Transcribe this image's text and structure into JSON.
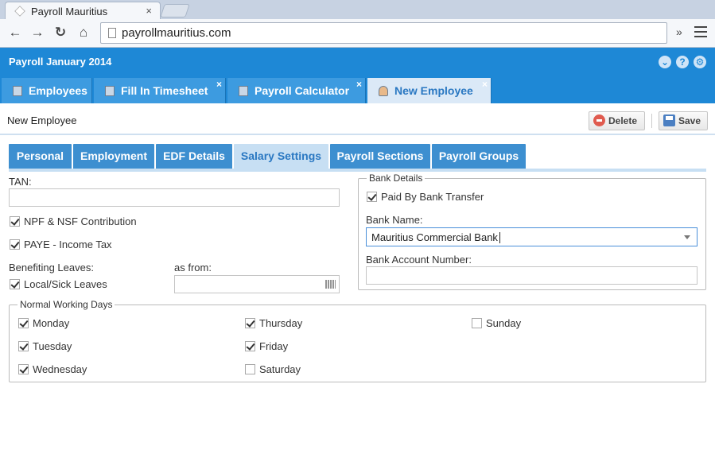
{
  "browser": {
    "tab_title": "Payroll Mauritius",
    "tab_close": "×",
    "url": "payrollmauritius.com",
    "nav": {
      "back": "←",
      "forward": "→",
      "reload": "↻",
      "home": "⌂"
    },
    "extra": "»"
  },
  "app": {
    "title": "Payroll January 2014",
    "header_icons": [
      "chevron-down-icon",
      "help-icon",
      "gear-icon"
    ],
    "tabs": [
      {
        "label": "Employees",
        "icon": "employees-icon"
      },
      {
        "label": "Fill In Timesheet",
        "icon": "timesheet-icon",
        "close": "×"
      },
      {
        "label": "Payroll Calculator",
        "icon": "calculator-icon",
        "close": "×"
      },
      {
        "label": "New Employee",
        "icon": "user-icon",
        "close": "×",
        "active": true
      }
    ]
  },
  "toolbar": {
    "title": "New Employee",
    "delete_label": "Delete",
    "save_label": "Save"
  },
  "subtabs": [
    "Personal",
    "Employment",
    "EDF Details",
    "Salary Settings",
    "Payroll Sections",
    "Payroll Groups"
  ],
  "form": {
    "tan_label": "TAN:",
    "tan_value": "",
    "npf_label": "NPF & NSF Contribution",
    "npf_checked": true,
    "paye_label": "PAYE - Income Tax",
    "paye_checked": true,
    "benefiting_label": "Benefiting Leaves:",
    "local_sick_label": "Local/Sick Leaves",
    "local_sick_checked": true,
    "as_from_label": "as from:",
    "as_from_value": ""
  },
  "bank": {
    "legend": "Bank Details",
    "paid_by_transfer_label": "Paid By Bank Transfer",
    "paid_by_transfer_checked": true,
    "bank_name_label": "Bank Name:",
    "bank_name_value": "Mauritius Commercial Bank",
    "account_label": "Bank Account Number:",
    "account_value": ""
  },
  "working_days": {
    "legend": "Normal Working Days",
    "days": [
      {
        "label": "Monday",
        "checked": true
      },
      {
        "label": "Tuesday",
        "checked": true
      },
      {
        "label": "Wednesday",
        "checked": true
      },
      {
        "label": "Thursday",
        "checked": true
      },
      {
        "label": "Friday",
        "checked": true
      },
      {
        "label": "Saturday",
        "checked": false
      },
      {
        "label": "Sunday",
        "checked": false
      }
    ]
  },
  "colors": {
    "header_blue": "#1e88d6",
    "tab_blue": "#3d9be0",
    "active_tab_bg": "#dbe9f7",
    "active_text": "#2a78c2"
  }
}
